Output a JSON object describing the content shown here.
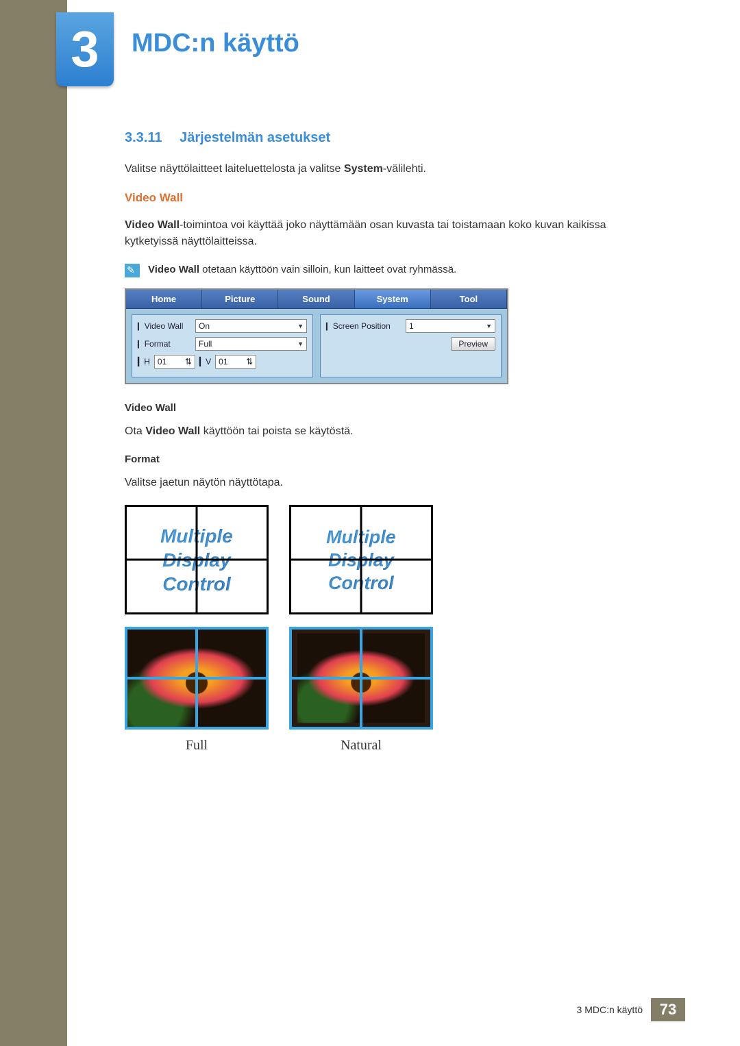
{
  "chapter": {
    "number": "3",
    "title": "MDC:n käyttö"
  },
  "section": {
    "number": "3.3.11",
    "title": "Järjestelmän asetukset"
  },
  "intro_before": "Valitse näyttölaitteet laiteluettelosta ja valitse ",
  "intro_bold": "System",
  "intro_after": "-välilehti.",
  "videowall": {
    "heading": "Video Wall",
    "desc_bold": "Video Wall",
    "desc_after": "-toimintoa voi käyttää joko näyttämään osan kuvasta tai toistamaan koko kuvan kaikissa kytketyissä näyttölaitteissa.",
    "note_bold": "Video Wall",
    "note_after": " otetaan käyttöön vain silloin, kun laitteet ovat ryhmässä."
  },
  "ui": {
    "tabs": [
      "Home",
      "Picture",
      "Sound",
      "System",
      "Tool"
    ],
    "active_tab": 3,
    "left": {
      "videowall_label": "Video Wall",
      "videowall_value": "On",
      "format_label": "Format",
      "format_value": "Full",
      "h_label": "H",
      "h_value": "01",
      "v_label": "V",
      "v_value": "01"
    },
    "right": {
      "screenpos_label": "Screen Position",
      "screenpos_value": "1",
      "preview_btn": "Preview"
    }
  },
  "sub_videowall": {
    "heading": "Video Wall",
    "text_before": "Ota ",
    "text_bold": "Video Wall",
    "text_after": " käyttöön tai poista se käytöstä."
  },
  "sub_format": {
    "heading": "Format",
    "text": "Valitse jaetun näytön näyttötapa."
  },
  "figure": {
    "mdc_line1": "Multiple",
    "mdc_line2": "Display",
    "mdc_line3": "Control",
    "caption_left": "Full",
    "caption_right": "Natural"
  },
  "footer": {
    "label": "3 MDC:n käyttö",
    "page": "73"
  }
}
